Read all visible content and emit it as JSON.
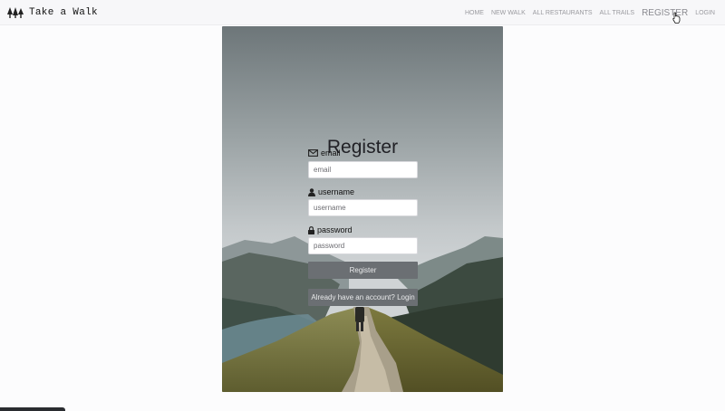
{
  "navbar": {
    "brand": "Take a Walk",
    "links": [
      "HOME",
      "NEW WALK",
      "ALL RESTAURANTS",
      "ALL TRAILS",
      "REGISTER",
      "LOGIN"
    ]
  },
  "register": {
    "title": "Register",
    "email_label": "email",
    "email_placeholder": "email",
    "username_label": "username",
    "username_placeholder": "username",
    "password_label": "password",
    "password_placeholder": "password",
    "submit_label": "Register",
    "login_link": "Already have an account? Login"
  },
  "icons": [
    "tree-logo-icon",
    "envelope-icon",
    "user-icon",
    "lock-icon",
    "pointer-cursor-icon"
  ],
  "colors": {
    "button": "#6b6f73",
    "active_nav": "#8a8a90",
    "nav": "#9a9a9f"
  }
}
